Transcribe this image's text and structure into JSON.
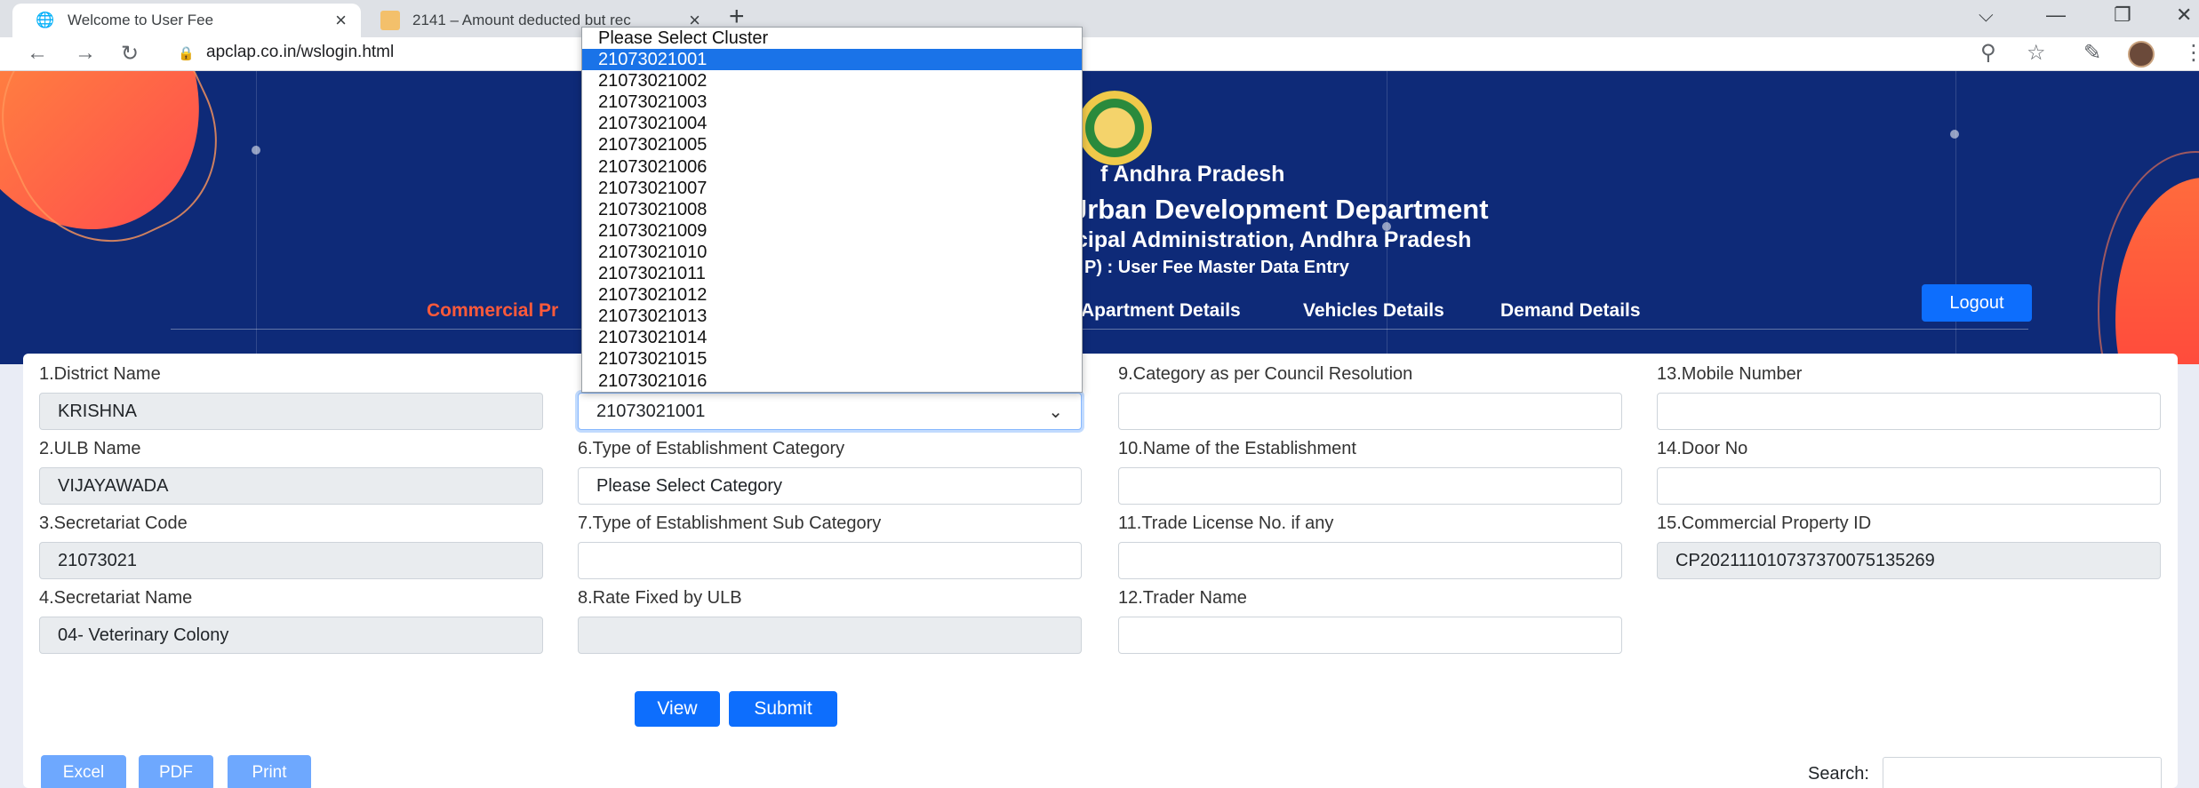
{
  "browser": {
    "tabs": [
      {
        "title": "Welcome to User Fee",
        "icon": "globe-icon",
        "active": true
      },
      {
        "title": "2141 – Amount deducted but rec",
        "icon": "page-icon",
        "active": false
      }
    ],
    "new_tab": "+",
    "url": "apclap.co.in/wslogin.html",
    "window_controls": [
      "⌵",
      "—",
      "❐",
      "✕"
    ]
  },
  "header": {
    "line1": "f Andhra Pradesh",
    "line2": "Jrban Development Department",
    "line3": "cipal Administration, Andhra Pradesh",
    "line4": "P) : User Fee Master Data Entry",
    "logout": "Logout",
    "menu": [
      {
        "label": "Commercial Pr",
        "active": true
      },
      {
        "label": "Apartment Details",
        "active": false
      },
      {
        "label": "Vehicles Details",
        "active": false
      },
      {
        "label": "Demand Details",
        "active": false
      }
    ]
  },
  "form": {
    "col1": [
      {
        "label": "1.District Name",
        "value": "KRISHNA"
      },
      {
        "label": "2.ULB Name",
        "value": "VIJAYAWADA"
      },
      {
        "label": "3.Secretariat Code",
        "value": "21073021"
      },
      {
        "label": "4.Secretariat Name",
        "value": "04- Veterinary Colony"
      }
    ],
    "col2": [
      {
        "label": "",
        "value": "21073021001"
      },
      {
        "label": "6.Type of Establishment Category",
        "value": "Please Select Category"
      },
      {
        "label": "7.Type of Establishment Sub Category",
        "value": ""
      },
      {
        "label": "8.Rate Fixed by ULB",
        "value": ""
      }
    ],
    "col3": [
      {
        "label": "9.Category as per Council Resolution",
        "value": ""
      },
      {
        "label": "10.Name of the Establishment",
        "value": ""
      },
      {
        "label": "11.Trade License No. if any",
        "value": ""
      },
      {
        "label": "12.Trader Name",
        "value": ""
      }
    ],
    "col4": [
      {
        "label": "13.Mobile Number",
        "value": ""
      },
      {
        "label": "14.Door No",
        "value": ""
      },
      {
        "label": "15.Commercial Property ID",
        "value": "CP202111010737370075135269"
      }
    ],
    "view_btn": "View",
    "submit_btn": "Submit",
    "export": [
      "Excel",
      "PDF",
      "Print"
    ],
    "search_label": "Search:"
  },
  "cluster_dropdown": {
    "selected": "21073021001",
    "options": [
      "Please Select Cluster",
      "21073021001",
      "21073021002",
      "21073021003",
      "21073021004",
      "21073021005",
      "21073021006",
      "21073021007",
      "21073021008",
      "21073021009",
      "21073021010",
      "21073021011",
      "21073021012",
      "21073021013",
      "21073021014",
      "21073021015",
      "21073021016"
    ]
  }
}
